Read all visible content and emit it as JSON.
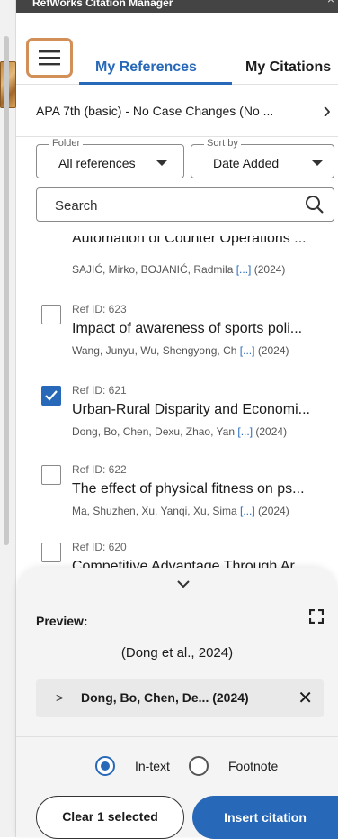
{
  "window": {
    "title": "RefWorks Citation Manager",
    "close_glyph": "×"
  },
  "tabs": {
    "menu_icon": "hamburger-icon",
    "active": "My References",
    "other": "My Citations"
  },
  "style_selector": {
    "label": "APA 7th (basic) - No Case Changes (No ...",
    "chevron": "›"
  },
  "filters": {
    "folder": {
      "legend": "Folder",
      "value": "All references"
    },
    "sort": {
      "legend": "Sort by",
      "value": "Date Added"
    }
  },
  "search": {
    "placeholder": "Search"
  },
  "references": [
    {
      "ref_id": "",
      "title": "Automation of Counter Operations ...",
      "authors": "SAJIĆ, Mirko, BOJANIĆ, Radmila",
      "more": "[...]",
      "year": "(2024)",
      "checked": false,
      "partial": true
    },
    {
      "ref_id": "Ref ID: 623",
      "title": "Impact of awareness of sports poli...",
      "authors": "Wang, Junyu, Wu, Shengyong, Ch",
      "more": "[...]",
      "year": "(2024)",
      "checked": false
    },
    {
      "ref_id": "Ref ID: 621",
      "title": "Urban-Rural Disparity and Economi...",
      "authors": "Dong, Bo, Chen, Dexu, Zhao, Yan",
      "more": "[...]",
      "year": "(2024)",
      "checked": true
    },
    {
      "ref_id": "Ref ID: 622",
      "title": "The effect of physical fitness on ps...",
      "authors": "Ma, Shuzhen, Xu, Yanqi, Xu, Sima",
      "more": "[...]",
      "year": "(2024)",
      "checked": false
    },
    {
      "ref_id": "Ref ID: 620",
      "title": "Competitive Advantage Through Ar...",
      "authors": "",
      "more": "",
      "year": "",
      "checked": false
    }
  ],
  "preview": {
    "label": "Preview:",
    "citation": "(Dong et al., 2024)",
    "entry": "Dong, Bo, Chen, De...  (2024)",
    "options": [
      {
        "label": "In-text",
        "selected": true
      },
      {
        "label": "Footnote",
        "selected": false
      }
    ],
    "clear_button": "Clear 1 selected",
    "insert_button": "Insert citation"
  },
  "colors": {
    "accent": "#2769b8",
    "highlight_border": "#d28f57"
  }
}
